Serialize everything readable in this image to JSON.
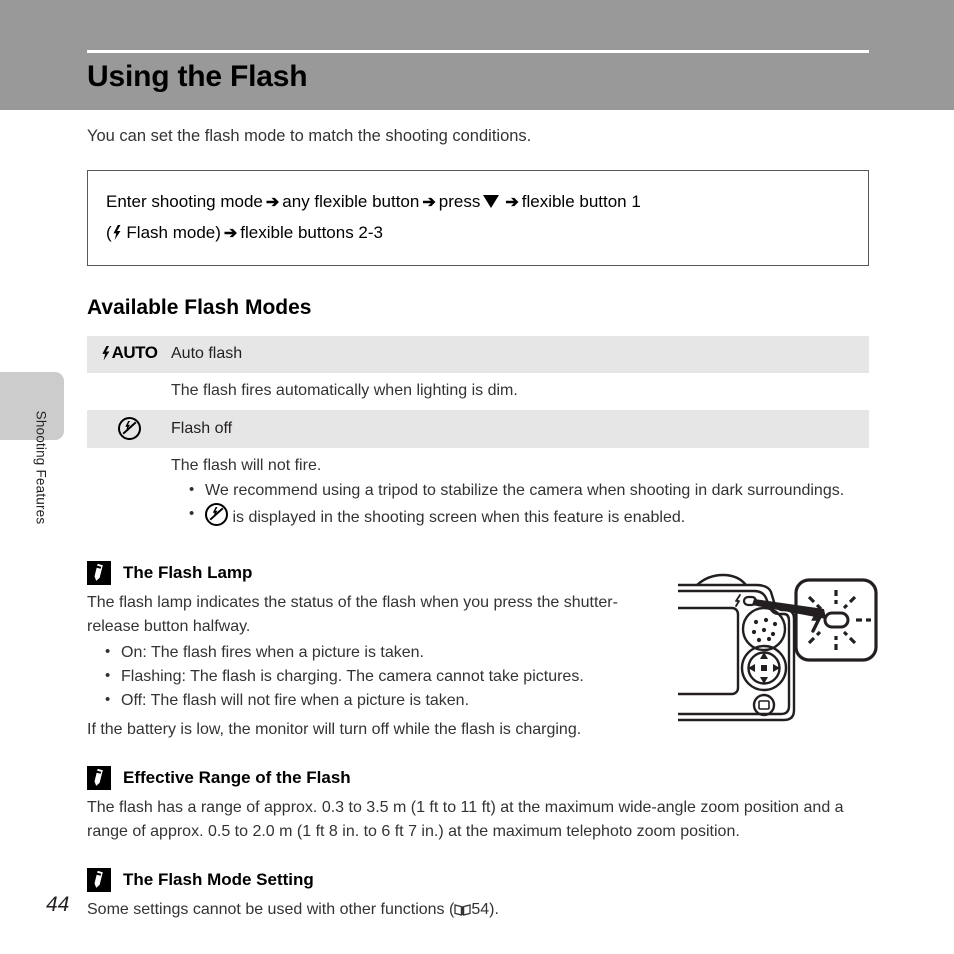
{
  "header": {
    "title": "Using the Flash"
  },
  "sidebar": {
    "chapter_label": "Shooting Features",
    "page_number": "44"
  },
  "intro": "You can set the flash mode to match the shooting conditions.",
  "procedure": {
    "line1_part1": "Enter shooting mode",
    "line1_part2": "any flexible button",
    "line1_part3": "press",
    "line1_part4": "flexible button 1",
    "line2_part1": "(",
    "line2_part2": "Flash mode)",
    "line2_part3": "flexible buttons 2-3",
    "arrow": "➔",
    "down_triangle_icon": "triangle-down-icon",
    "flash_bolt_icon": "flash-bolt-icon"
  },
  "available_modes": {
    "heading": "Available Flash Modes",
    "rows": [
      {
        "icon": "flash-auto-icon",
        "icon_text": "AUTO",
        "label": "Auto flash",
        "description": "The flash fires automatically when lighting is dim.",
        "bullets": []
      },
      {
        "icon": "flash-off-icon",
        "icon_text": "",
        "label": "Flash off",
        "description": "The flash will not fire.",
        "bullets": [
          "We recommend using a tripod to stabilize the camera when shooting in dark surroundings.",
          "is displayed in the shooting screen when this feature is enabled."
        ]
      }
    ]
  },
  "notes": [
    {
      "icon": "pencil-note-icon",
      "title": "The Flash Lamp",
      "paragraph": "The flash lamp indicates the status of the flash when you press the shutter-release button halfway.",
      "bullets": [
        "On: The flash fires when a picture is taken.",
        "Flashing: The flash is charging. The camera cannot take pictures.",
        "Off: The flash will not fire when a picture is taken."
      ],
      "closing": "If the battery is low, the monitor will turn off while the flash is charging."
    },
    {
      "icon": "pencil-note-icon",
      "title": "Effective Range of the Flash",
      "paragraph": "The flash has a range of approx. 0.3 to 3.5 m (1 ft to 11 ft) at the maximum wide-angle zoom position and a range of approx. 0.5 to 2.0 m (1 ft 8 in. to 6 ft 7 in.) at the maximum telephoto zoom position."
    },
    {
      "icon": "pencil-note-icon",
      "title": "The Flash Mode Setting",
      "paragraph_before": "Some settings cannot be used with other functions (",
      "reference_icon": "book-icon",
      "reference_page": "54",
      "paragraph_after": ")."
    }
  ],
  "figure": {
    "name": "camera-back-flash-lamp-illustration",
    "callout": "flash-lamp-glow-callout"
  },
  "colors": {
    "header_band": "#999999",
    "side_tab": "#cccccc",
    "table_row_shade": "#e6e6e6",
    "text": "#333333"
  }
}
